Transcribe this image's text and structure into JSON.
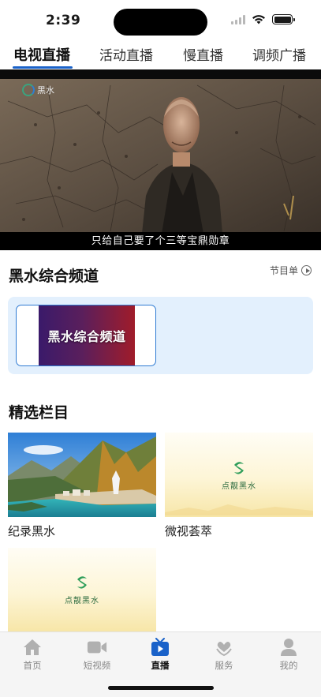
{
  "status": {
    "time": "2:39"
  },
  "top_tabs": [
    {
      "label": "电视直播",
      "active": true
    },
    {
      "label": "活动直播",
      "active": false
    },
    {
      "label": "慢直播",
      "active": false
    },
    {
      "label": "调频广播",
      "active": false
    }
  ],
  "video": {
    "channel_logo_text": "黑水",
    "subtitle": "只给自己要了个三等宝鼎勋章"
  },
  "channel_section": {
    "title": "黑水综合频道",
    "schedule_label": "节目单",
    "channels": [
      {
        "name": "黑水综合频道"
      }
    ]
  },
  "featured": {
    "title": "精选栏目",
    "items": [
      {
        "label": "纪录黑水"
      },
      {
        "label": "微视荟萃",
        "logo_text": "点靓黑水"
      },
      {
        "label": "",
        "logo_text": "点靓黑水"
      }
    ]
  },
  "tabbar": {
    "items": [
      {
        "label": "首页",
        "icon": "home-icon",
        "active": false
      },
      {
        "label": "短视频",
        "icon": "video-camera-icon",
        "active": false
      },
      {
        "label": "直播",
        "icon": "live-play-icon",
        "active": true
      },
      {
        "label": "服务",
        "icon": "service-heart-icon",
        "active": false
      },
      {
        "label": "我的",
        "icon": "profile-icon",
        "active": false
      }
    ]
  },
  "colors": {
    "accent": "#1a62c9",
    "panel_bg": "#e3f0fd",
    "tabbar_bg": "#f5f5f5",
    "inactive_icon": "#b0b0b0"
  }
}
